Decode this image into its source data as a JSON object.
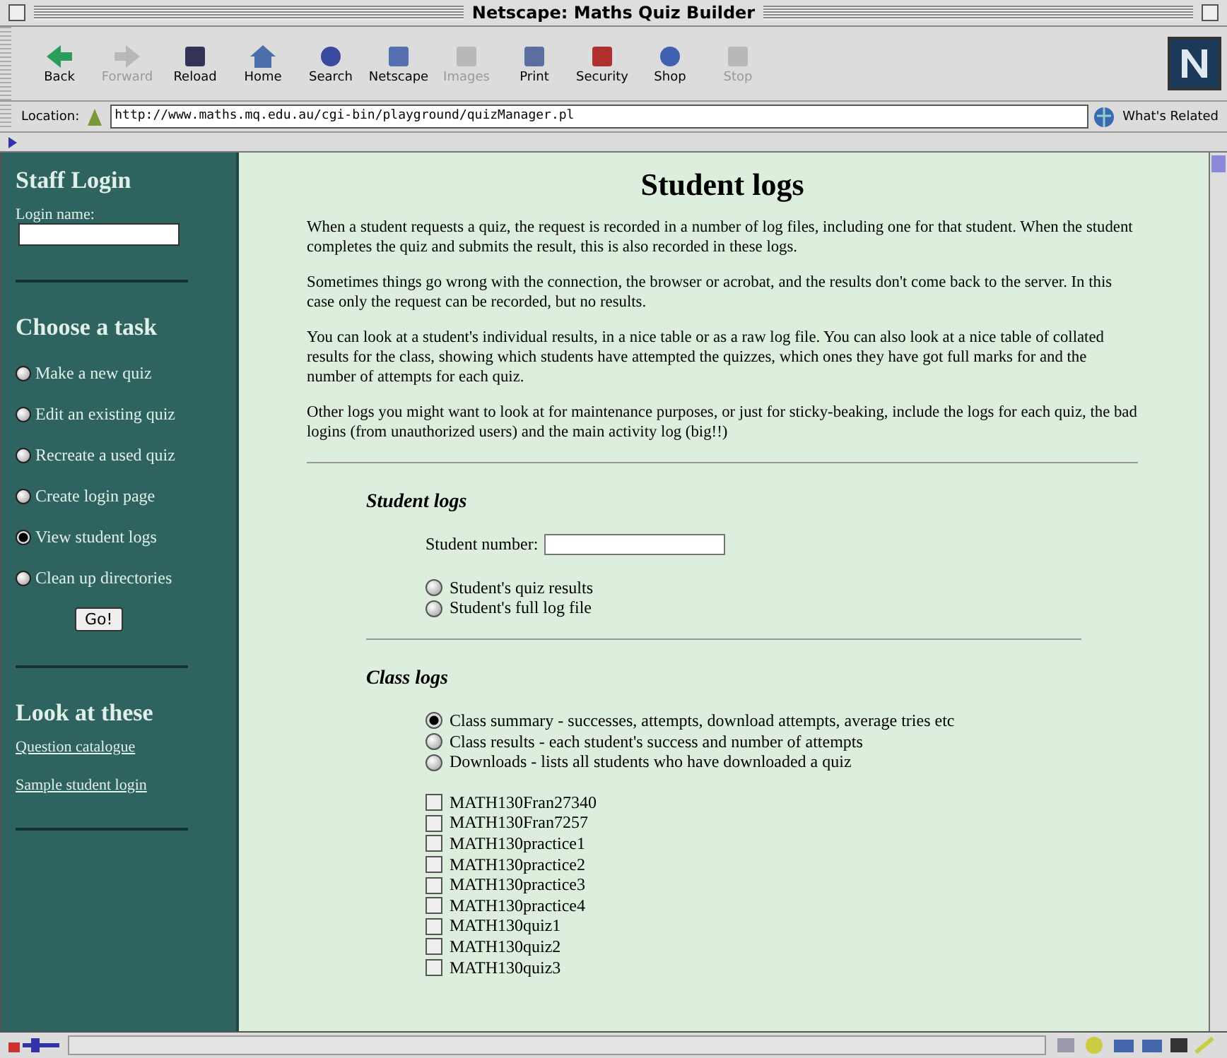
{
  "window": {
    "title": "Netscape: Maths Quiz Builder"
  },
  "toolbar": [
    {
      "label": "Back",
      "kind": "back",
      "disabled": false
    },
    {
      "label": "Forward",
      "kind": "forward",
      "disabled": true
    },
    {
      "label": "Reload",
      "kind": "reload",
      "disabled": false
    },
    {
      "label": "Home",
      "kind": "home",
      "disabled": false
    },
    {
      "label": "Search",
      "kind": "search",
      "disabled": false
    },
    {
      "label": "Netscape",
      "kind": "my",
      "disabled": false
    },
    {
      "label": "Images",
      "kind": "images",
      "disabled": true
    },
    {
      "label": "Print",
      "kind": "print",
      "disabled": false
    },
    {
      "label": "Security",
      "kind": "security",
      "disabled": false
    },
    {
      "label": "Shop",
      "kind": "shop",
      "disabled": false
    },
    {
      "label": "Stop",
      "kind": "stop",
      "disabled": true
    }
  ],
  "location": {
    "label": "Location:",
    "url": "http://www.maths.mq.edu.au/cgi-bin/playground/quizManager.pl",
    "related": "What's Related"
  },
  "sidebar": {
    "login_heading": "Staff Login",
    "login_label": "Login name:",
    "task_heading": "Choose a task",
    "tasks": [
      {
        "label": "Make a new quiz",
        "selected": false
      },
      {
        "label": "Edit an existing quiz",
        "selected": false
      },
      {
        "label": "Recreate a used quiz",
        "selected": false
      },
      {
        "label": "Create login page",
        "selected": false
      },
      {
        "label": "View student logs",
        "selected": true
      },
      {
        "label": "Clean up directories",
        "selected": false
      }
    ],
    "go_button": "Go!",
    "look_heading": "Look at these",
    "links": [
      "Question catalogue",
      "Sample student login"
    ]
  },
  "main": {
    "title": "Student logs",
    "paragraphs": [
      "When a student requests a quiz, the request is recorded in a number of log files, including one for that student. When the student completes the quiz and submits the result, this is also recorded in these logs.",
      "Sometimes things go wrong with the connection, the browser or acrobat, and the results don't come back to the server. In this case only the request can be recorded, but no results.",
      "You can look at a student's individual results, in a nice table or as a raw log file. You can also look at a nice table of collated results for the class, showing which students have attempted the quizzes, which ones they have got full marks for and the number of attempts for each quiz.",
      "Other logs you might want to look at for maintenance purposes, or just for sticky-beaking, include the logs for each quiz, the bad logins (from unauthorized users) and the main activity log (big!!)"
    ],
    "student_heading": "Student logs",
    "student_number_label": "Student number:",
    "student_options": [
      {
        "label": "Student's quiz results",
        "selected": false
      },
      {
        "label": "Student's full log file",
        "selected": false
      }
    ],
    "class_heading": "Class logs",
    "class_options": [
      {
        "label": "Class summary - successes, attempts, download attempts, average tries etc",
        "selected": true
      },
      {
        "label": "Class results - each student's success and number of attempts",
        "selected": false
      },
      {
        "label": "Downloads - lists all students who have downloaded a quiz",
        "selected": false
      }
    ],
    "quizzes": [
      {
        "label": "MATH130Fran27340",
        "checked": false
      },
      {
        "label": "MATH130Fran7257",
        "checked": false
      },
      {
        "label": "MATH130practice1",
        "checked": false
      },
      {
        "label": "MATH130practice2",
        "checked": false
      },
      {
        "label": "MATH130practice3",
        "checked": false
      },
      {
        "label": "MATH130practice4",
        "checked": false
      },
      {
        "label": "MATH130quiz1",
        "checked": false
      },
      {
        "label": "MATH130quiz2",
        "checked": false
      },
      {
        "label": "MATH130quiz3",
        "checked": false
      }
    ]
  }
}
